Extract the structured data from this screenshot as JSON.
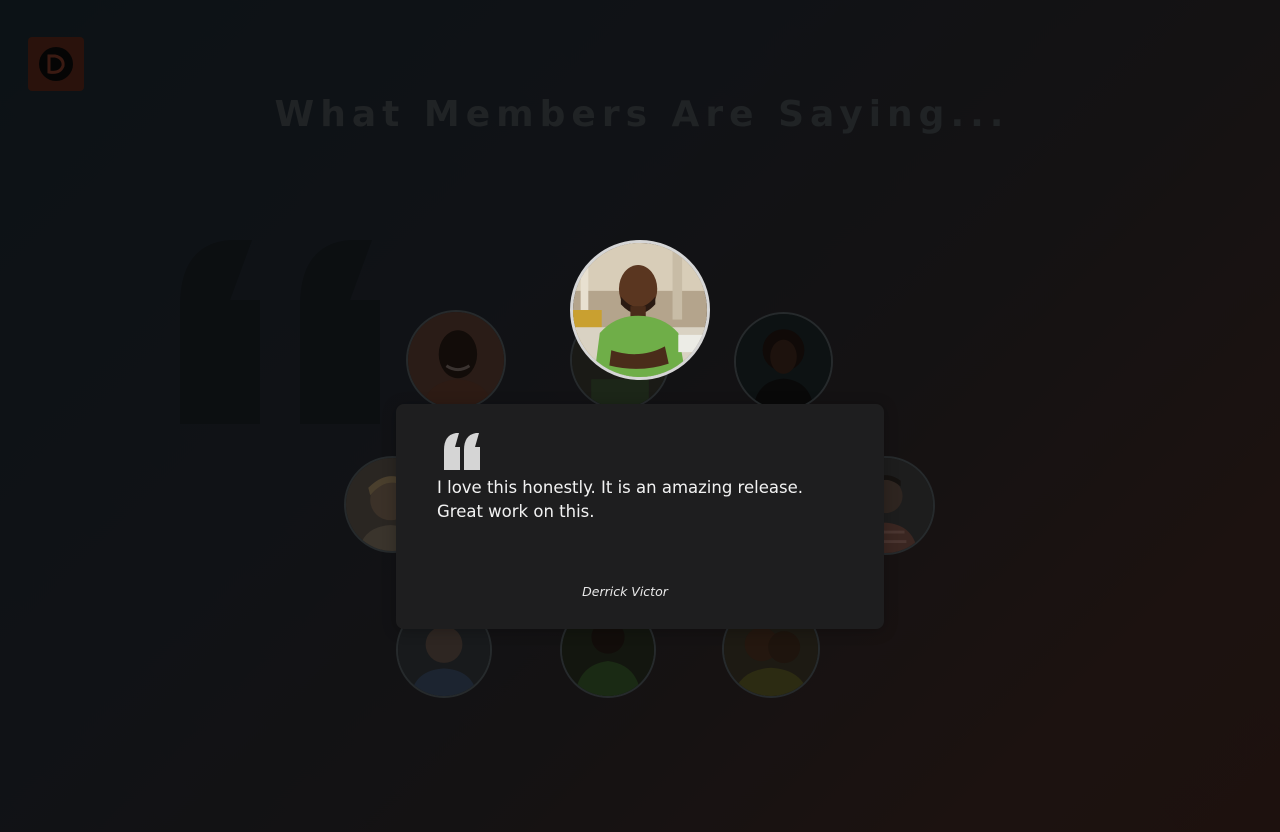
{
  "header": {
    "logo_icon": "brand-logo-icon",
    "title": "What Members Are Saying..."
  },
  "decorative": {
    "big_quote_icon": "quote-mark-icon"
  },
  "featured": {
    "quote": "I love this honestly. It is an amazing release. Great work on this.",
    "author": "Derrick Victor",
    "quote_icon": "quote-mark-icon"
  },
  "colors": {
    "brand_accent": "#2a120c",
    "card_background": "#1e1e1f",
    "featured_ring": "#d6d6d6"
  }
}
